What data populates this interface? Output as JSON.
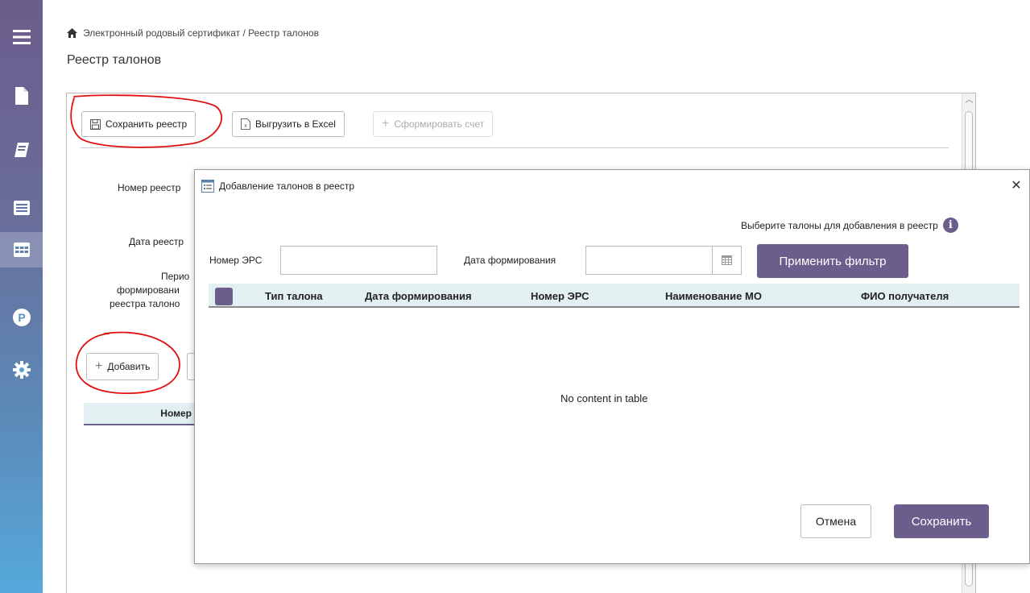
{
  "sidebar": {
    "items": [
      {
        "icon": "menu-icon"
      },
      {
        "icon": "document-icon"
      },
      {
        "icon": "book-icon"
      },
      {
        "icon": "list-icon"
      },
      {
        "icon": "table-icon",
        "active": true
      },
      {
        "icon": "parking-icon"
      },
      {
        "icon": "gear-icon"
      }
    ]
  },
  "breadcrumb": {
    "icon": "home-icon",
    "text": "Электронный родовый сертификат / Реестр талонов"
  },
  "page_title": "Реестр талонов",
  "toolbar": {
    "save_label": "Сохранить реестр",
    "excel_label": "Выгрузить в Excel",
    "invoice_label": "Сформировать счет"
  },
  "form": {
    "registry_number_label": "Номер реестр",
    "registry_date_label": "Дата реестр",
    "period_label_1": "Перио",
    "period_label_2": "формировани",
    "period_label_3": "реестра талоно",
    "add_label": "Добавить",
    "table_col_number": "Номер"
  },
  "dialog": {
    "title": "Добавление талонов в реестр",
    "hint": "Выберите талоны для добавления в реестр",
    "filter": {
      "ers_label": "Номер ЭРС",
      "ers_value": "",
      "date_label": "Дата формирования",
      "date_value": "",
      "apply_label": "Применить фильтр"
    },
    "columns": [
      "Тип талона",
      "Дата формирования",
      "Номер ЭРС",
      "Наименование МО",
      "ФИО получателя"
    ],
    "empty_text": "No content in table",
    "cancel_label": "Отмена",
    "save_label": "Сохранить"
  },
  "colors": {
    "accent": "#6b5d8c",
    "header_bg": "#e3f0f2",
    "annotation": "#e01010"
  }
}
